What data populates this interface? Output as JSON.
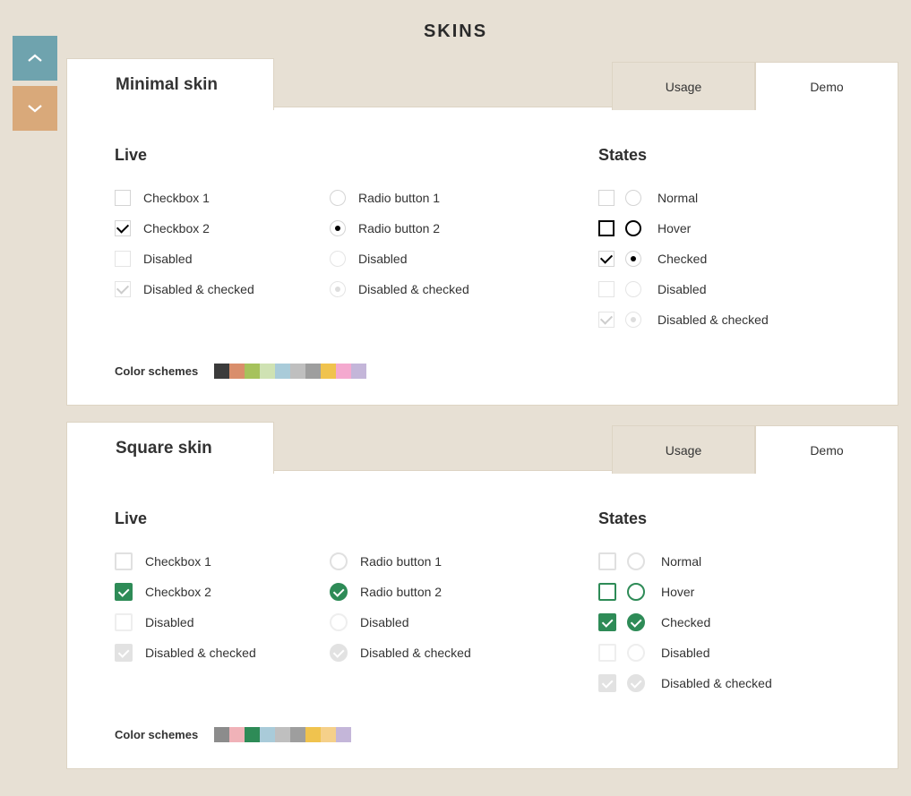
{
  "pageTitle": "SKINS",
  "tabs": {
    "usage": "Usage",
    "demo": "Demo"
  },
  "sections": {
    "live": "Live",
    "states": "States"
  },
  "live": {
    "cb1": "Checkbox 1",
    "cb2": "Checkbox 2",
    "disabled": "Disabled",
    "dchecked": "Disabled & checked",
    "rb1": "Radio button 1",
    "rb2": "Radio button 2"
  },
  "states": {
    "normal": "Normal",
    "hover": "Hover",
    "checked": "Checked",
    "disabled": "Disabled",
    "dchecked": "Disabled & checked"
  },
  "colorSchemesLabel": "Color schemes",
  "skins": [
    {
      "id": "minimal",
      "title": "Minimal skin",
      "swatches": [
        "#3b3b3b",
        "#d98e6b",
        "#a6c25c",
        "#cfe2b3",
        "#a9cbd9",
        "#bfbfbf",
        "#9e9e9e",
        "#f0c34e",
        "#f4a9cf",
        "#c4b6d9"
      ]
    },
    {
      "id": "square",
      "title": "Square skin",
      "swatches": [
        "#8c8c8c",
        "#f0b2b8",
        "#2e8b57",
        "#a9cbd9",
        "#bfbfbf",
        "#9e9e9e",
        "#f0c34e",
        "#f5d08a",
        "#c4b6d9"
      ]
    }
  ]
}
